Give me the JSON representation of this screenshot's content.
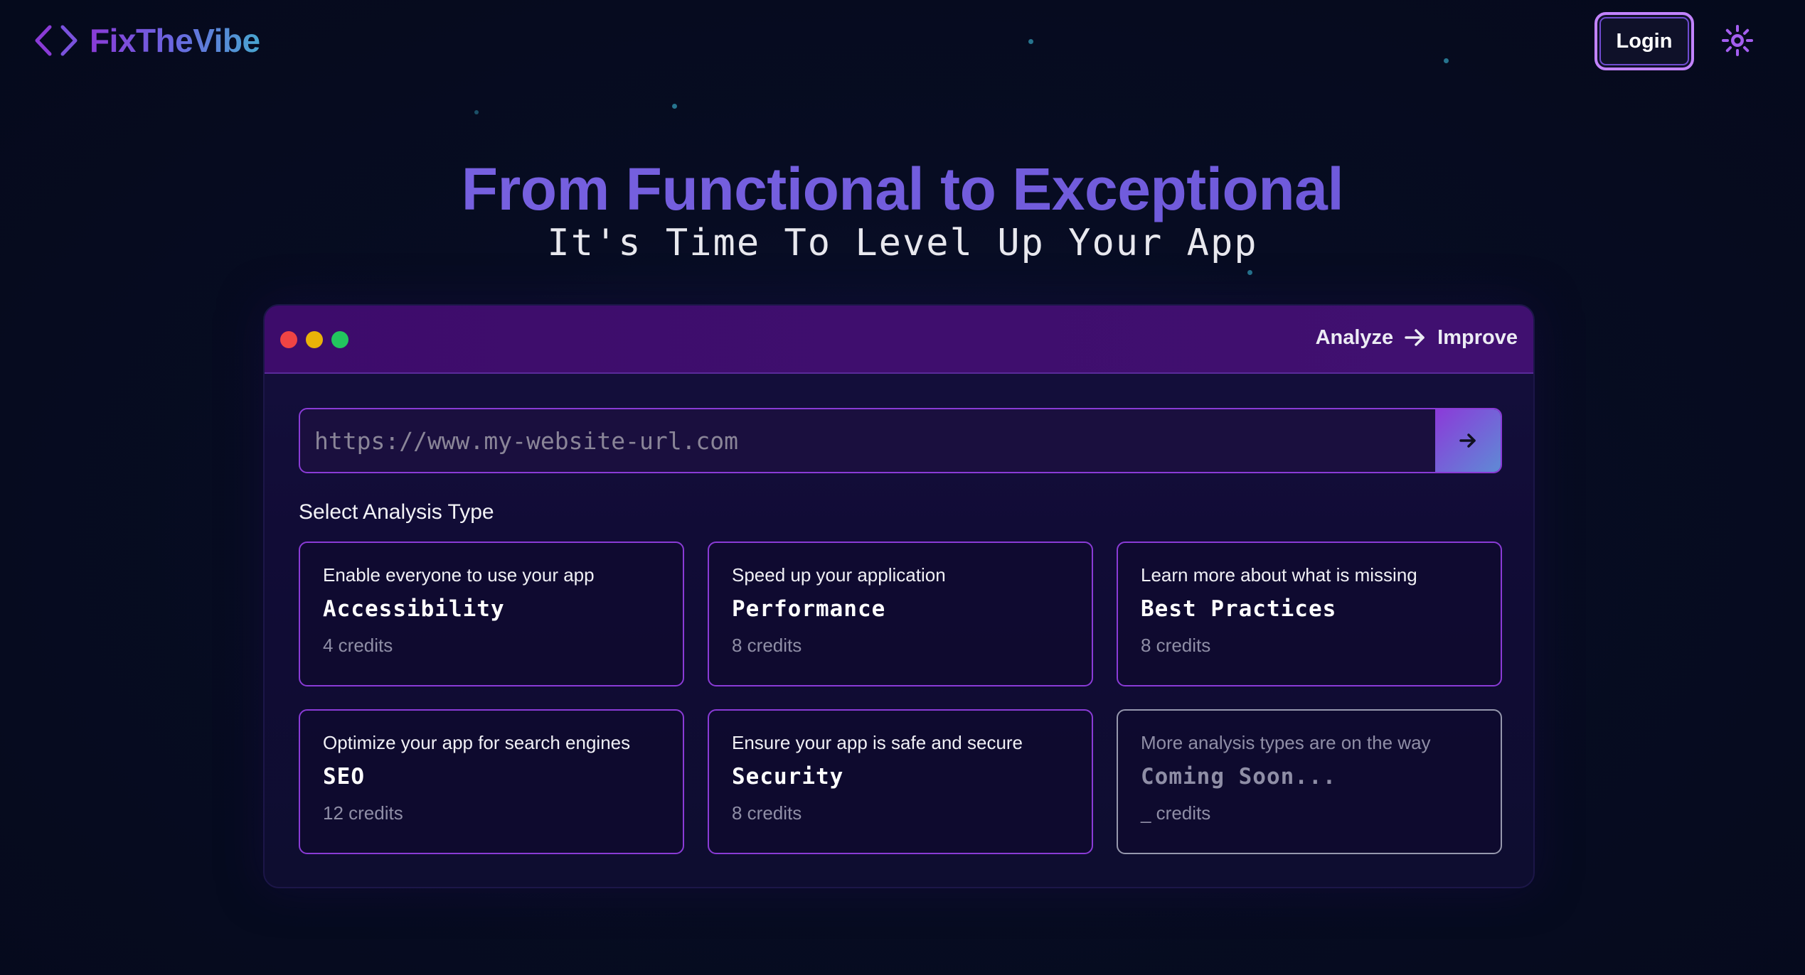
{
  "header": {
    "brand": "FixTheVibe",
    "login_label": "Login",
    "theme_icon": "sun-icon"
  },
  "hero": {
    "title": "From Functional to Exceptional",
    "subtitle": "It's Time To Level Up Your App"
  },
  "window": {
    "title_left": "Analyze",
    "title_right": "Improve",
    "url_placeholder": "https://www.my-website-url.com",
    "url_value": "",
    "section_label": "Select Analysis Type",
    "cards": [
      {
        "desc": "Enable everyone to use your app",
        "name": "Accessibility",
        "credits": "4 credits"
      },
      {
        "desc": "Speed up your application",
        "name": "Performance",
        "credits": "8 credits"
      },
      {
        "desc": "Learn more about what is missing",
        "name": "Best Practices",
        "credits": "8 credits"
      },
      {
        "desc": "Optimize your app for search engines",
        "name": "SEO",
        "credits": "12 credits"
      },
      {
        "desc": "Ensure your app is safe and secure",
        "name": "Security",
        "credits": "8 credits"
      },
      {
        "desc": "More analysis types are on the way",
        "name": "Coming Soon...",
        "credits": "_ credits"
      }
    ]
  },
  "colors": {
    "accent": "#8a3bd6",
    "background": "#050a1e",
    "titlebar": "#3d0c6b"
  }
}
